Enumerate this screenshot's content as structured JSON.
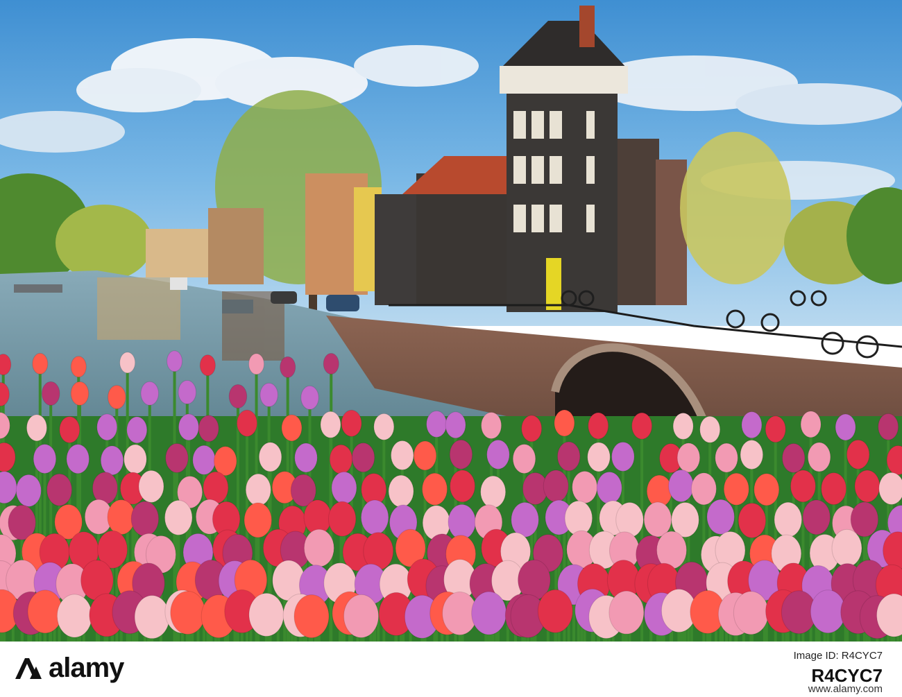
{
  "branding": {
    "logo_text": "alamy",
    "image_id_label": "Image ID: R4CYC7",
    "image_id": "R4CYC7",
    "site_url": "www.alamy.com",
    "footer_background": "#ffffff"
  },
  "scene": {
    "sky_color": "#5aa5dc",
    "water_color": "#4f7f94",
    "tulip_colors": [
      "#e2314a",
      "#f29ab3",
      "#c46acb",
      "#ff5a4a",
      "#f7c2c8",
      "#b8356f"
    ]
  }
}
